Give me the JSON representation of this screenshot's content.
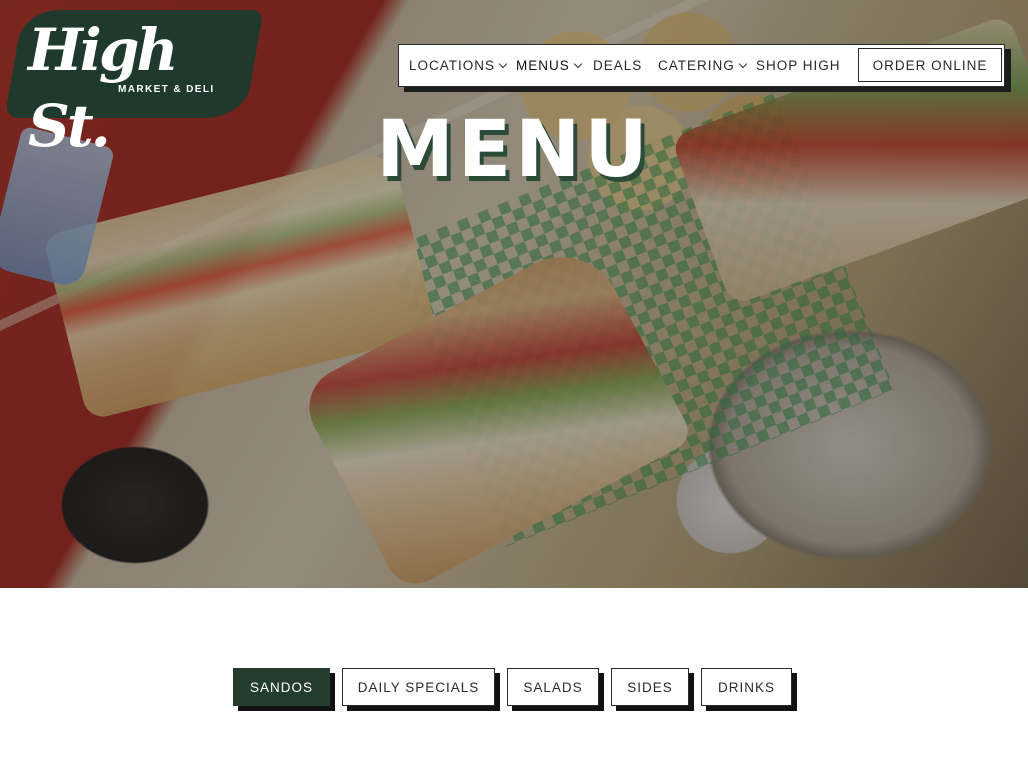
{
  "brand": {
    "name": "High St.",
    "tagline": "MARKET & DELI",
    "colors": {
      "primary_green": "#243d2f",
      "title_shadow": "#2b4a38"
    }
  },
  "nav": {
    "items": [
      {
        "label": "LOCATIONS",
        "dropdown": true
      },
      {
        "label": "MENUS",
        "dropdown": true,
        "active": true
      },
      {
        "label": "DEALS",
        "dropdown": false
      },
      {
        "label": "CATERING",
        "dropdown": true
      },
      {
        "label": "SHOP HIGH",
        "dropdown": false
      }
    ],
    "order_button": "ORDER ONLINE"
  },
  "hero": {
    "title": "MENU"
  },
  "menu_tabs": [
    {
      "label": "SANDOS",
      "active": true
    },
    {
      "label": "DAILY SPECIALS",
      "active": false
    },
    {
      "label": "SALADS",
      "active": false
    },
    {
      "label": "SIDES",
      "active": false
    },
    {
      "label": "DRINKS",
      "active": false
    }
  ]
}
